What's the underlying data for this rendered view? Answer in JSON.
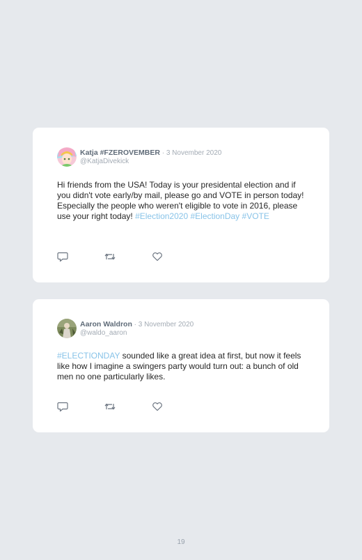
{
  "tweets": [
    {
      "name": "Katja #FZEROVEMBER",
      "separator": " · ",
      "date": "3 November 2020",
      "handle": "@KatjaDivekick",
      "text_parts": [
        {
          "text": "Hi friends from the USA! Today is your presidental election and if you didn't vote early/by mail, please go and VOTE in person today! Especially the people who weren't eligible to vote in 2016, please use your right today! ",
          "hashtag": false
        },
        {
          "text": "#Election2020",
          "hashtag": true
        },
        {
          "text": " ",
          "hashtag": false
        },
        {
          "text": "#ElectionDay",
          "hashtag": true
        },
        {
          "text": " ",
          "hashtag": false
        },
        {
          "text": "#VOTE",
          "hashtag": true
        }
      ]
    },
    {
      "name": "Aaron Waldron",
      "separator": " · ",
      "date": "3 November 2020",
      "handle": "@waldo_aaron",
      "text_parts": [
        {
          "text": "#ELECTIONDAY",
          "hashtag": true
        },
        {
          "text": " sounded like a great idea at first, but now it feels like how I imagine a swingers party would turn out: a bunch of old men no one particularly likes.",
          "hashtag": false
        }
      ]
    }
  ],
  "icons": {
    "reply": "reply-icon",
    "retweet": "retweet-icon",
    "like": "heart-icon"
  },
  "colors": {
    "page_background": "#e6e9ed",
    "card": "#ffffff",
    "hashtag": "#88c3e8",
    "name": "#5f6b78",
    "muted": "#a3abb4",
    "text": "#262626"
  },
  "page_number": "19"
}
